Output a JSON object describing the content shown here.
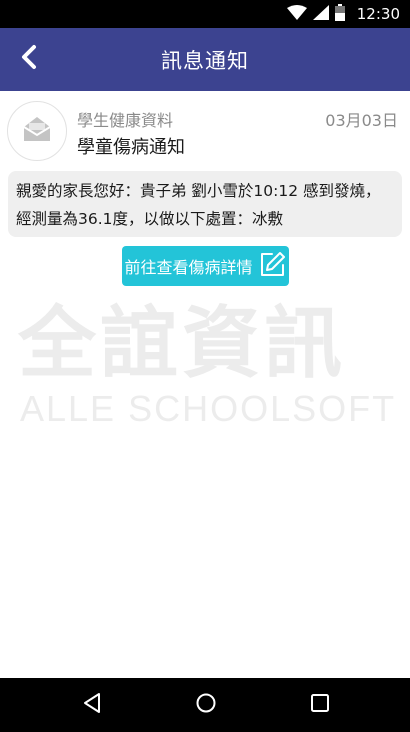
{
  "status_bar": {
    "time": "12:30",
    "icons": [
      "wifi-icon",
      "signal-icon",
      "battery-icon"
    ]
  },
  "app_bar": {
    "title": "訊息通知",
    "back_icon": "back-arrow-icon",
    "background_color": "#3c4390"
  },
  "notification": {
    "icon": "envelope-icon",
    "category": "學生健康資料",
    "date": "03月03日",
    "subject": "學童傷病通知",
    "message_line1": "親愛的家長您好：貴子弟 劉小雪於10:12 感到發燒，",
    "message_line2": "經測量為36.1度，以做以下處置：冰敷"
  },
  "detail_button": {
    "label": "前往查看傷病詳情",
    "icon": "edit-icon",
    "color": "#23c4d8"
  },
  "watermark": {
    "chinese": "全誼資訊",
    "english": "ALLE SCHOOLSOFT"
  },
  "nav_bar": {
    "buttons": [
      "back-triangle-icon",
      "home-circle-icon",
      "recents-square-icon"
    ]
  }
}
